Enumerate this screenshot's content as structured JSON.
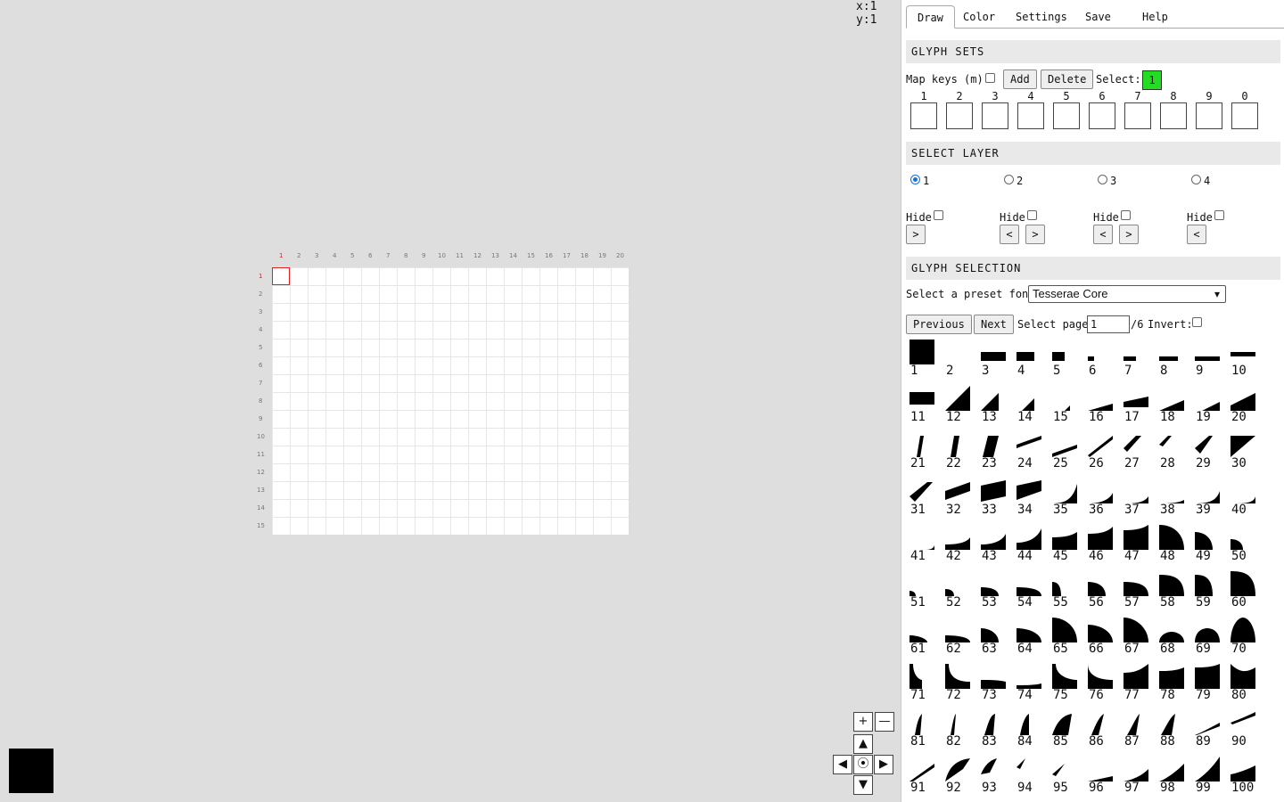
{
  "canvas": {
    "coords_text": "x:1 y:1",
    "current_color": "#000000",
    "col_labels": [
      "1",
      "2",
      "3",
      "4",
      "5",
      "6",
      "7",
      "8",
      "9",
      "10",
      "11",
      "12",
      "13",
      "14",
      "15",
      "16",
      "17",
      "18",
      "19",
      "20"
    ],
    "row_labels": [
      "1",
      "2",
      "3",
      "4",
      "5",
      "6",
      "7",
      "8",
      "9",
      "10",
      "11",
      "12",
      "13",
      "14",
      "15"
    ]
  },
  "nav": {
    "zoom_in": "+",
    "zoom_out": "—",
    "up": "▲",
    "down": "▼",
    "left": "◀",
    "right": "▶",
    "center": "⦿"
  },
  "tabs": [
    "Draw",
    "Color",
    "Settings",
    "Save",
    "Help"
  ],
  "glyph_sets": {
    "header": "GLYPH SETS",
    "map_keys_label": "Map keys (m):",
    "add_label": "Add",
    "delete_label": "Delete",
    "select_label": "Select:",
    "select_value": "1",
    "slot_labels": [
      "1",
      "2",
      "3",
      "4",
      "5",
      "6",
      "7",
      "8",
      "9",
      "0"
    ]
  },
  "layers": {
    "header": "SELECT LAYER",
    "radios": [
      "1",
      "2",
      "3",
      "4"
    ],
    "selected": "1",
    "hide_label": "Hide",
    "prev": "<",
    "next": ">"
  },
  "glyph_selection": {
    "header": "GLYPH SELECTION",
    "preset_label": "Select a preset font:",
    "preset_value": "Tesserae Core",
    "previous_label": "Previous",
    "next_label": "Next",
    "page_label": "Select page:",
    "page_value": "1",
    "page_total": "/6",
    "invert_label": "Invert:",
    "glyph_numbers": [
      "1",
      "2",
      "3",
      "4",
      "5",
      "6",
      "7",
      "8",
      "9",
      "10",
      "11",
      "12",
      "13",
      "14",
      "15",
      "16",
      "17",
      "18",
      "19",
      "20",
      "21",
      "22",
      "23",
      "24",
      "25",
      "26",
      "27",
      "28",
      "29",
      "30",
      "31",
      "32",
      "33",
      "34",
      "35",
      "36",
      "37",
      "38",
      "39",
      "40",
      "41",
      "42",
      "43",
      "44",
      "45",
      "46",
      "47",
      "48",
      "49",
      "50",
      "51",
      "52",
      "53",
      "54",
      "55",
      "56",
      "57",
      "58",
      "59",
      "60",
      "61",
      "62",
      "63",
      "64",
      "65",
      "66",
      "67",
      "68",
      "69",
      "70",
      "71",
      "72",
      "73",
      "74",
      "75",
      "76",
      "77",
      "78",
      "79",
      "80",
      "81",
      "82",
      "83",
      "84",
      "85",
      "86",
      "87",
      "88",
      "89",
      "90",
      "91",
      "92",
      "93",
      "94",
      "95",
      "96",
      "97",
      "98",
      "99",
      "100"
    ]
  }
}
